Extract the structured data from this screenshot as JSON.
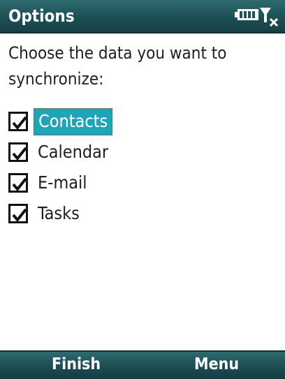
{
  "header": {
    "title": "Options",
    "battery_icon": "battery-icon",
    "signal_icon": "no-signal-icon",
    "bg_color": "#1f5459"
  },
  "main": {
    "prompt": "Choose the data you want to synchronize:",
    "items": [
      {
        "label": "Contacts",
        "checked": true,
        "selected": true
      },
      {
        "label": "Calendar",
        "checked": true,
        "selected": false
      },
      {
        "label": "E-mail",
        "checked": true,
        "selected": false
      },
      {
        "label": "Tasks",
        "checked": true,
        "selected": false
      }
    ],
    "highlight_color": "#1ea6b8"
  },
  "softkeys": {
    "left": "Finish",
    "right": "Menu"
  }
}
